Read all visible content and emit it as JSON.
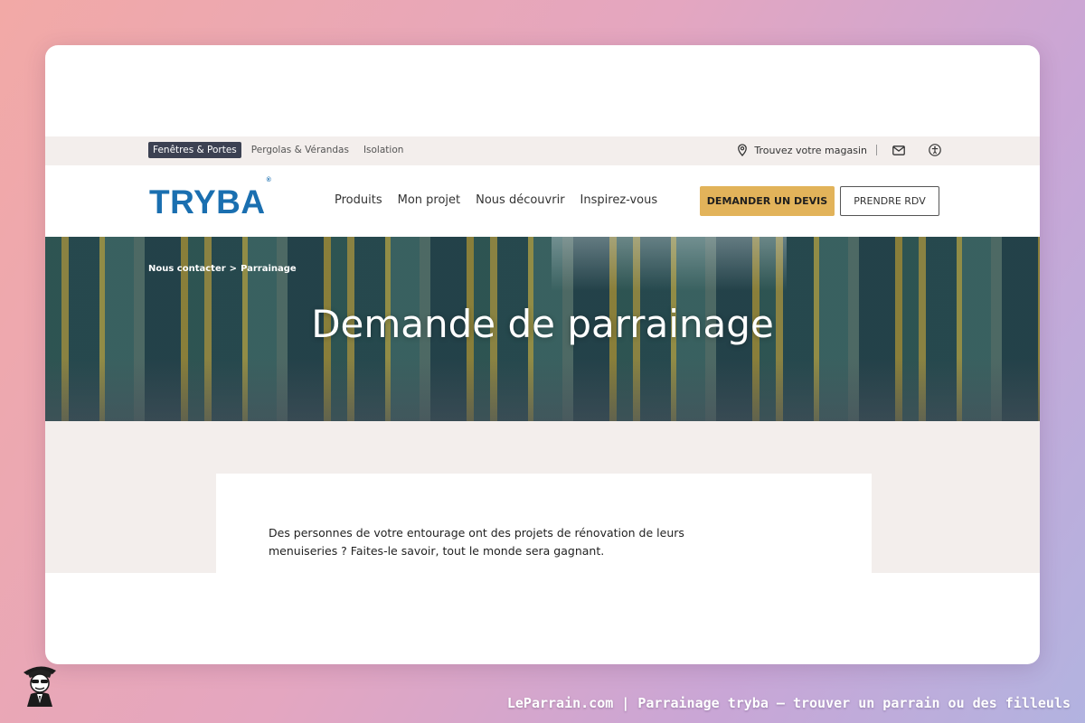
{
  "topbar": {
    "segments": [
      "Fenêtres & Portes",
      "Pergolas & Vérandas",
      "Isolation"
    ],
    "store_label": "Trouvez votre magasin",
    "icons": [
      "location-pin-icon",
      "mail-icon",
      "accessibility-icon"
    ]
  },
  "nav": {
    "logo": "TRYBA",
    "logo_mark": "®",
    "menu": [
      "Produits",
      "Mon projet",
      "Nous découvrir",
      "Inspirez-vous"
    ],
    "cta_primary": "DEMANDER UN DEVIS",
    "cta_secondary": "PRENDRE RDV"
  },
  "hero": {
    "breadcrumb": [
      "Nous contacter",
      "Parrainage"
    ],
    "breadcrumb_sep": ">",
    "title": "Demande de parrainage"
  },
  "content": {
    "intro": "Des personnes de votre entourage ont des projets de rénovation de leurs menuiseries ? Faites-le savoir, tout le monde sera gagnant."
  },
  "caption": "LeParrain.com | Parrainage tryba — trouver un parrain ou des filleuls",
  "colors": {
    "brand_blue": "#1a6fb0",
    "cta_gold": "#e2b35a",
    "topbar_active": "#3c4152",
    "beige_bg": "#f3eeec"
  }
}
